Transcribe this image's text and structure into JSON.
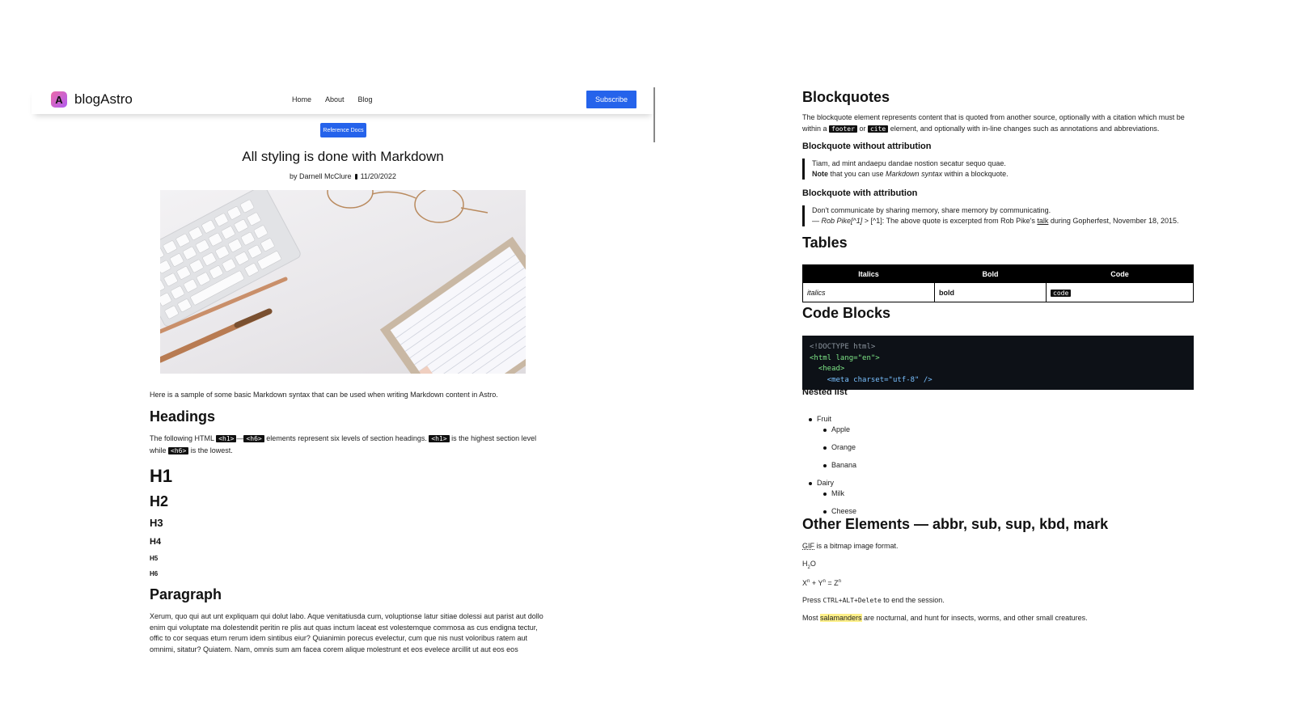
{
  "header": {
    "logo_letter": "A",
    "brand": "blogAstro",
    "nav": [
      "Home",
      "About",
      "Blog"
    ],
    "subscribe": "Subscribe"
  },
  "post": {
    "ref_docs": "Reference Docs",
    "title": "All styling is done with Markdown",
    "author": "by Darnell McClure",
    "date": "11/20/2022",
    "intro": "Here is a sample of some basic Markdown syntax that can be used when writing Markdown content in Astro.",
    "headings_title": "Headings",
    "headings_p1": "The following HTML ",
    "headings_c1": "<h1>",
    "headings_dash": "—",
    "headings_c2": "<h6>",
    "headings_p2": " elements represent six levels of section headings. ",
    "headings_c3": "<h1>",
    "headings_p3": " is the highest section level while ",
    "headings_c4": "<h6>",
    "headings_p4": " is the lowest.",
    "h1": "H1",
    "h2": "H2",
    "h3": "H3",
    "h4": "H4",
    "h5": "H5",
    "h6": "H6",
    "paragraph_title": "Paragraph",
    "paragraph_text": "Xerum, quo qui aut unt expliquam qui dolut labo. Aque venitatiusda cum, voluptionse latur sitiae dolessi aut parist aut dollo enim qui voluptate ma dolestendit peritin re plis aut quas inctum laceat est volestemque commosa as cus endigna tectur, offic to cor sequas etum rerum idem sintibus eiur? Quianimin porecus evelectur, cum que nis nust voloribus ratem aut omnimi, sitatur? Quiatem. Nam, omnis sum am facea corem alique molestrunt et eos evelece arcillit ut aut eos eos"
  },
  "right": {
    "blockquotes_title": "Blockquotes",
    "bq_intro_1": "The blockquote element represents content that is quoted from another source, optionally with a citation which must be",
    "bq_intro_2a": "within a ",
    "bq_code_footer": "footer",
    "bq_or": " or ",
    "bq_code_cite": "cite",
    "bq_intro_2b": " element, and optionally with in-line changes such as annotations and abbreviations.",
    "bq_no_attr_title": "Blockquote without attribution",
    "bq_no_attr_line1": "Tiam, ad mint andaepu dandae nostion secatur sequo quae.",
    "bq_note_bold": "Note",
    "bq_note_mid": " that you can use ",
    "bq_note_em": "Markdown syntax",
    "bq_note_end": " within a blockquote.",
    "bq_attr_title": "Blockquote with attribution",
    "bq_attr_line1": "Don't communicate by sharing memory, share memory by communicating.",
    "bq_attr_em": "— Rob Pike[^1]",
    "bq_attr_mid": " > [^1]: The above quote is excerpted from Rob Pike's ",
    "bq_attr_link": "talk",
    "bq_attr_end": " during Gopherfest, November 18, 2015.",
    "tables_title": "Tables",
    "table": {
      "headers": [
        "Italics",
        "Bold",
        "Code"
      ],
      "row": [
        "italics",
        "bold",
        "code"
      ]
    },
    "code_title": "Code Blocks",
    "code_lines": [
      "<!DOCTYPE html>",
      "<html lang=\"en\">",
      "  <head>",
      "    <meta charset=\"utf-8\" />"
    ],
    "nested_title": "Nested list",
    "nested": {
      "fruit": "Fruit",
      "fruits": [
        "Apple",
        "Orange",
        "Banana"
      ],
      "dairy": "Dairy",
      "dairies": [
        "Milk",
        "Cheese"
      ]
    },
    "other_title": "Other Elements — abbr, sub, sup, kbd, mark",
    "gif_abbr": "GIF",
    "gif_rest": " is a bitmap image format.",
    "h2o_h": "H",
    "h2o_2": "2",
    "h2o_o": "O",
    "x_base": "X",
    "n_sup": "n",
    "plus": " + Y",
    "eq": " = Z",
    "press": "Press ",
    "kbd_keys": "CTRL+ALT+Delete",
    "press_end": " to end the session.",
    "most": "Most ",
    "salamanders": "salamanders",
    "most_end": " are nocturnal, and hunt for insects, worms, and other small creatures."
  }
}
